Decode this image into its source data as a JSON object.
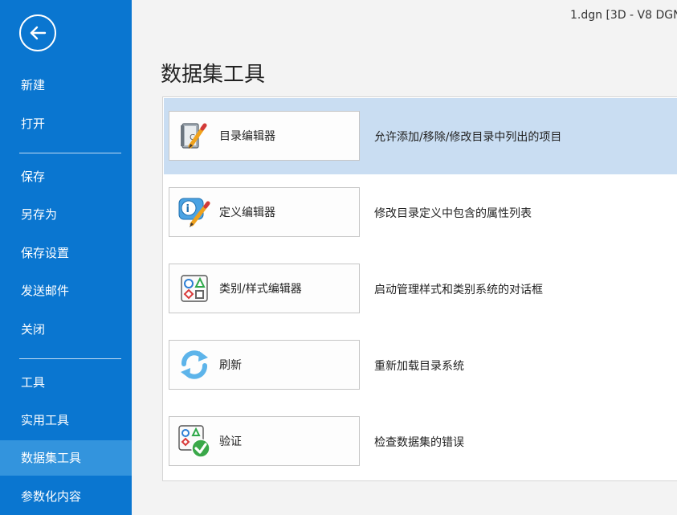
{
  "window": {
    "title": "1.dgn [3D - V8 DGN"
  },
  "sidebar": {
    "back_icon": "back-arrow-icon",
    "items": [
      {
        "label": "新建"
      },
      {
        "label": "打开"
      },
      {
        "label": "保存"
      },
      {
        "label": "另存为"
      },
      {
        "label": "保存设置"
      },
      {
        "label": "发送邮件"
      },
      {
        "label": "关闭"
      },
      {
        "label": "工具"
      },
      {
        "label": "实用工具"
      },
      {
        "label": "数据集工具",
        "active": true
      },
      {
        "label": "参数化内容"
      }
    ]
  },
  "main": {
    "title": "数据集工具",
    "tools": [
      {
        "label": "目录编辑器",
        "description": "允许添加/移除/修改目录中列出的项目",
        "icon": "catalog-editor-icon",
        "selected": true
      },
      {
        "label": "定义编辑器",
        "description": "修改目录定义中包含的属性列表",
        "icon": "definition-editor-icon"
      },
      {
        "label": "类别/样式编辑器",
        "description": "启动管理样式和类别系统的对话框",
        "icon": "category-style-editor-icon"
      },
      {
        "label": "刷新",
        "description": "重新加载目录系统",
        "icon": "refresh-icon"
      },
      {
        "label": "验证",
        "description": "检查数据集的错误",
        "icon": "validate-icon"
      }
    ]
  },
  "colors": {
    "sidebar_bg": "#0a76d0",
    "sidebar_active": "#3394dd",
    "selected_row": "#c9ddf2"
  }
}
